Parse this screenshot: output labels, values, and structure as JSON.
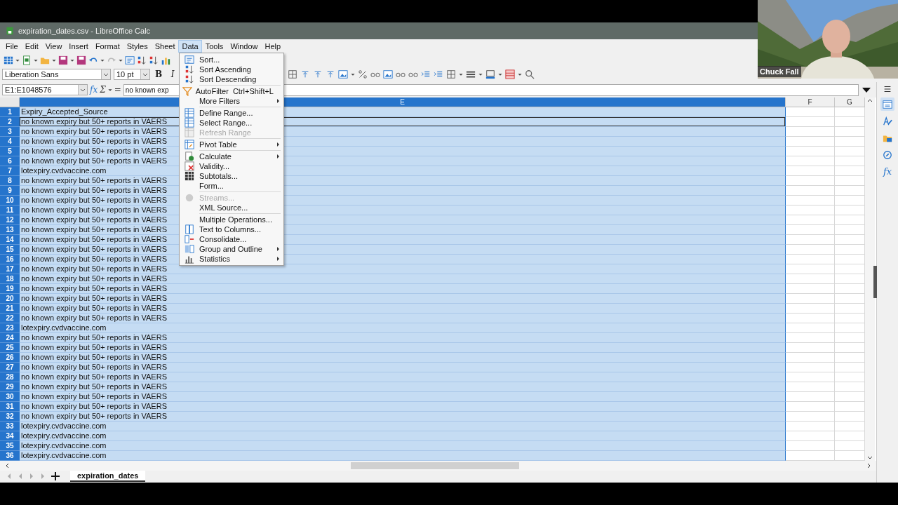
{
  "window": {
    "title": "expiration_dates.csv - LibreOffice Calc"
  },
  "menu_bar": [
    {
      "label": "File",
      "selected": false
    },
    {
      "label": "Edit",
      "selected": false
    },
    {
      "label": "View",
      "selected": false
    },
    {
      "label": "Insert",
      "selected": false
    },
    {
      "label": "Format",
      "selected": false
    },
    {
      "label": "Styles",
      "selected": false
    },
    {
      "label": "Sheet",
      "selected": false
    },
    {
      "label": "Data",
      "selected": true
    },
    {
      "label": "Tools",
      "selected": false
    },
    {
      "label": "Window",
      "selected": false
    },
    {
      "label": "Help",
      "selected": false
    }
  ],
  "format_bar": {
    "font_name": "Liberation Sans",
    "font_size": "10 pt",
    "bold": "B",
    "italic": "I"
  },
  "formula_bar": {
    "name_box": "E1:E1048576",
    "function_wizard": "fx",
    "sum": "Σ",
    "equals": "=",
    "content": "no known exp"
  },
  "columns": [
    {
      "label": "E",
      "selected": true
    },
    {
      "label": "F",
      "selected": false
    },
    {
      "label": "G",
      "selected": false
    }
  ],
  "rows": [
    {
      "number": "1",
      "value": "Expiry_Accepted_Source",
      "cursor": false
    },
    {
      "number": "2",
      "value": "no known expiry but 50+ reports in VAERS",
      "cursor": true
    },
    {
      "number": "3",
      "value": "no known expiry but 50+ reports in VAERS",
      "cursor": false
    },
    {
      "number": "4",
      "value": "no known expiry but 50+ reports in VAERS",
      "cursor": false
    },
    {
      "number": "5",
      "value": "no known expiry but 50+ reports in VAERS",
      "cursor": false
    },
    {
      "number": "6",
      "value": "no known expiry but 50+ reports in VAERS",
      "cursor": false
    },
    {
      "number": "7",
      "value": "lotexpiry.cvdvaccine.com",
      "cursor": false
    },
    {
      "number": "8",
      "value": "no known expiry but 50+ reports in VAERS",
      "cursor": false
    },
    {
      "number": "9",
      "value": "no known expiry but 50+ reports in VAERS",
      "cursor": false
    },
    {
      "number": "10",
      "value": "no known expiry but 50+ reports in VAERS",
      "cursor": false
    },
    {
      "number": "11",
      "value": "no known expiry but 50+ reports in VAERS",
      "cursor": false
    },
    {
      "number": "12",
      "value": "no known expiry but 50+ reports in VAERS",
      "cursor": false
    },
    {
      "number": "13",
      "value": "no known expiry but 50+ reports in VAERS",
      "cursor": false
    },
    {
      "number": "14",
      "value": "no known expiry but 50+ reports in VAERS",
      "cursor": false
    },
    {
      "number": "15",
      "value": "no known expiry but 50+ reports in VAERS",
      "cursor": false
    },
    {
      "number": "16",
      "value": "no known expiry but 50+ reports in VAERS",
      "cursor": false
    },
    {
      "number": "17",
      "value": "no known expiry but 50+ reports in VAERS",
      "cursor": false
    },
    {
      "number": "18",
      "value": "no known expiry but 50+ reports in VAERS",
      "cursor": false
    },
    {
      "number": "19",
      "value": "no known expiry but 50+ reports in VAERS",
      "cursor": false
    },
    {
      "number": "20",
      "value": "no known expiry but 50+ reports in VAERS",
      "cursor": false
    },
    {
      "number": "21",
      "value": "no known expiry but 50+ reports in VAERS",
      "cursor": false
    },
    {
      "number": "22",
      "value": "no known expiry but 50+ reports in VAERS",
      "cursor": false
    },
    {
      "number": "23",
      "value": "lotexpiry.cvdvaccine.com",
      "cursor": false
    },
    {
      "number": "24",
      "value": "no known expiry but 50+ reports in VAERS",
      "cursor": false
    },
    {
      "number": "25",
      "value": "no known expiry but 50+ reports in VAERS",
      "cursor": false
    },
    {
      "number": "26",
      "value": "no known expiry but 50+ reports in VAERS",
      "cursor": false
    },
    {
      "number": "27",
      "value": "no known expiry but 50+ reports in VAERS",
      "cursor": false
    },
    {
      "number": "28",
      "value": "no known expiry but 50+ reports in VAERS",
      "cursor": false
    },
    {
      "number": "29",
      "value": "no known expiry but 50+ reports in VAERS",
      "cursor": false
    },
    {
      "number": "30",
      "value": "no known expiry but 50+ reports in VAERS",
      "cursor": false
    },
    {
      "number": "31",
      "value": "no known expiry but 50+ reports in VAERS",
      "cursor": false
    },
    {
      "number": "32",
      "value": "no known expiry but 50+ reports in VAERS",
      "cursor": false
    },
    {
      "number": "33",
      "value": "lotexpiry.cvdvaccine.com",
      "cursor": false
    },
    {
      "number": "34",
      "value": "lotexpiry.cvdvaccine.com",
      "cursor": false
    },
    {
      "number": "35",
      "value": "lotexpiry.cvdvaccine.com",
      "cursor": false
    },
    {
      "number": "36",
      "value": "lotexpiry.cvdvaccine.com",
      "cursor": false
    }
  ],
  "data_menu": [
    {
      "kind": "item",
      "label": "Sort...",
      "disabled": false,
      "submenu": false
    },
    {
      "kind": "item",
      "label": "Sort Ascending",
      "disabled": false,
      "submenu": false
    },
    {
      "kind": "item",
      "label": "Sort Descending",
      "disabled": false,
      "submenu": false
    },
    {
      "kind": "separator"
    },
    {
      "kind": "item",
      "label": "AutoFilter",
      "shortcut": "Ctrl+Shift+L",
      "disabled": false,
      "submenu": false
    },
    {
      "kind": "item",
      "label": "More Filters",
      "disabled": false,
      "submenu": true
    },
    {
      "kind": "separator"
    },
    {
      "kind": "item",
      "label": "Define Range...",
      "disabled": false,
      "submenu": false
    },
    {
      "kind": "item",
      "label": "Select Range...",
      "disabled": false,
      "submenu": false
    },
    {
      "kind": "item",
      "label": "Refresh Range",
      "disabled": true,
      "submenu": false
    },
    {
      "kind": "separator"
    },
    {
      "kind": "item",
      "label": "Pivot Table",
      "disabled": false,
      "submenu": true
    },
    {
      "kind": "separator"
    },
    {
      "kind": "item",
      "label": "Calculate",
      "disabled": false,
      "submenu": true
    },
    {
      "kind": "item",
      "label": "Validity...",
      "disabled": false,
      "submenu": false
    },
    {
      "kind": "item",
      "label": "Subtotals...",
      "disabled": false,
      "submenu": false
    },
    {
      "kind": "item",
      "label": "Form...",
      "disabled": false,
      "submenu": false
    },
    {
      "kind": "separator"
    },
    {
      "kind": "item",
      "label": "Streams...",
      "disabled": true,
      "submenu": false
    },
    {
      "kind": "item",
      "label": "XML Source...",
      "disabled": false,
      "submenu": false
    },
    {
      "kind": "separator"
    },
    {
      "kind": "item",
      "label": "Multiple Operations...",
      "disabled": false,
      "submenu": false
    },
    {
      "kind": "item",
      "label": "Text to Columns...",
      "disabled": false,
      "submenu": false
    },
    {
      "kind": "item",
      "label": "Consolidate...",
      "disabled": false,
      "submenu": false
    },
    {
      "kind": "item",
      "label": "Group and Outline",
      "disabled": false,
      "submenu": true
    },
    {
      "kind": "item",
      "label": "Statistics",
      "disabled": false,
      "submenu": true
    }
  ],
  "sidebar": {
    "functions": "fx"
  },
  "sheet_tabs": [
    {
      "label": "expiration_dates",
      "selected": true
    }
  ],
  "webcam": {
    "kind": "picture",
    "name": "Chuck Fall"
  }
}
